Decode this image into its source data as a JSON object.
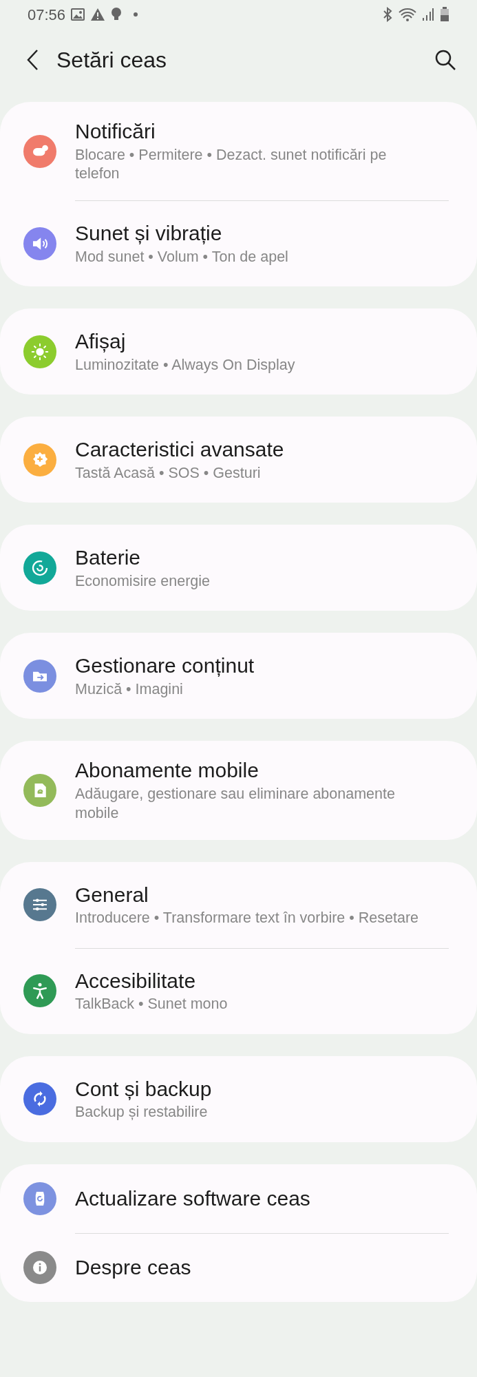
{
  "status_bar": {
    "time": "07:56"
  },
  "header": {
    "title": "Setări ceas"
  },
  "groups": [
    {
      "items": [
        {
          "title": "Notificări",
          "subtitle": "Blocare • Permitere • Dezact. sunet notificări pe telefon",
          "color": "#f07b6b"
        },
        {
          "title": "Sunet și vibrație",
          "subtitle": "Mod sunet • Volum • Ton de apel",
          "color": "#8585ee"
        }
      ]
    },
    {
      "items": [
        {
          "title": "Afișaj",
          "subtitle": "Luminozitate • Always On Display",
          "color": "#8ccc2e"
        }
      ]
    },
    {
      "items": [
        {
          "title": "Caracteristici avansate",
          "subtitle": "Tastă Acasă • SOS • Gesturi",
          "color": "#fbae40"
        }
      ]
    },
    {
      "items": [
        {
          "title": "Baterie",
          "subtitle": "Economisire energie",
          "color": "#12a898"
        }
      ]
    },
    {
      "items": [
        {
          "title": "Gestionare conținut",
          "subtitle": "Muzică • Imagini",
          "color": "#7b8fe0"
        }
      ]
    },
    {
      "items": [
        {
          "title": "Abonamente mobile",
          "subtitle": "Adăugare, gestionare sau eliminare abonamente mobile",
          "color": "#93ba5a"
        }
      ]
    },
    {
      "items": [
        {
          "title": "General",
          "subtitle": "Introducere • Transformare text în vorbire • Resetare",
          "color": "#57788f"
        },
        {
          "title": "Accesibilitate",
          "subtitle": "TalkBack • Sunet mono",
          "color": "#2f9a55"
        }
      ]
    },
    {
      "items": [
        {
          "title": "Cont și backup",
          "subtitle": "Backup și restabilire",
          "color": "#4a6ce0"
        }
      ]
    },
    {
      "items": [
        {
          "title": "Actualizare software ceas",
          "color": "#7d92e0"
        },
        {
          "title": "Despre ceas",
          "color": "#8a8a8a"
        }
      ]
    }
  ]
}
